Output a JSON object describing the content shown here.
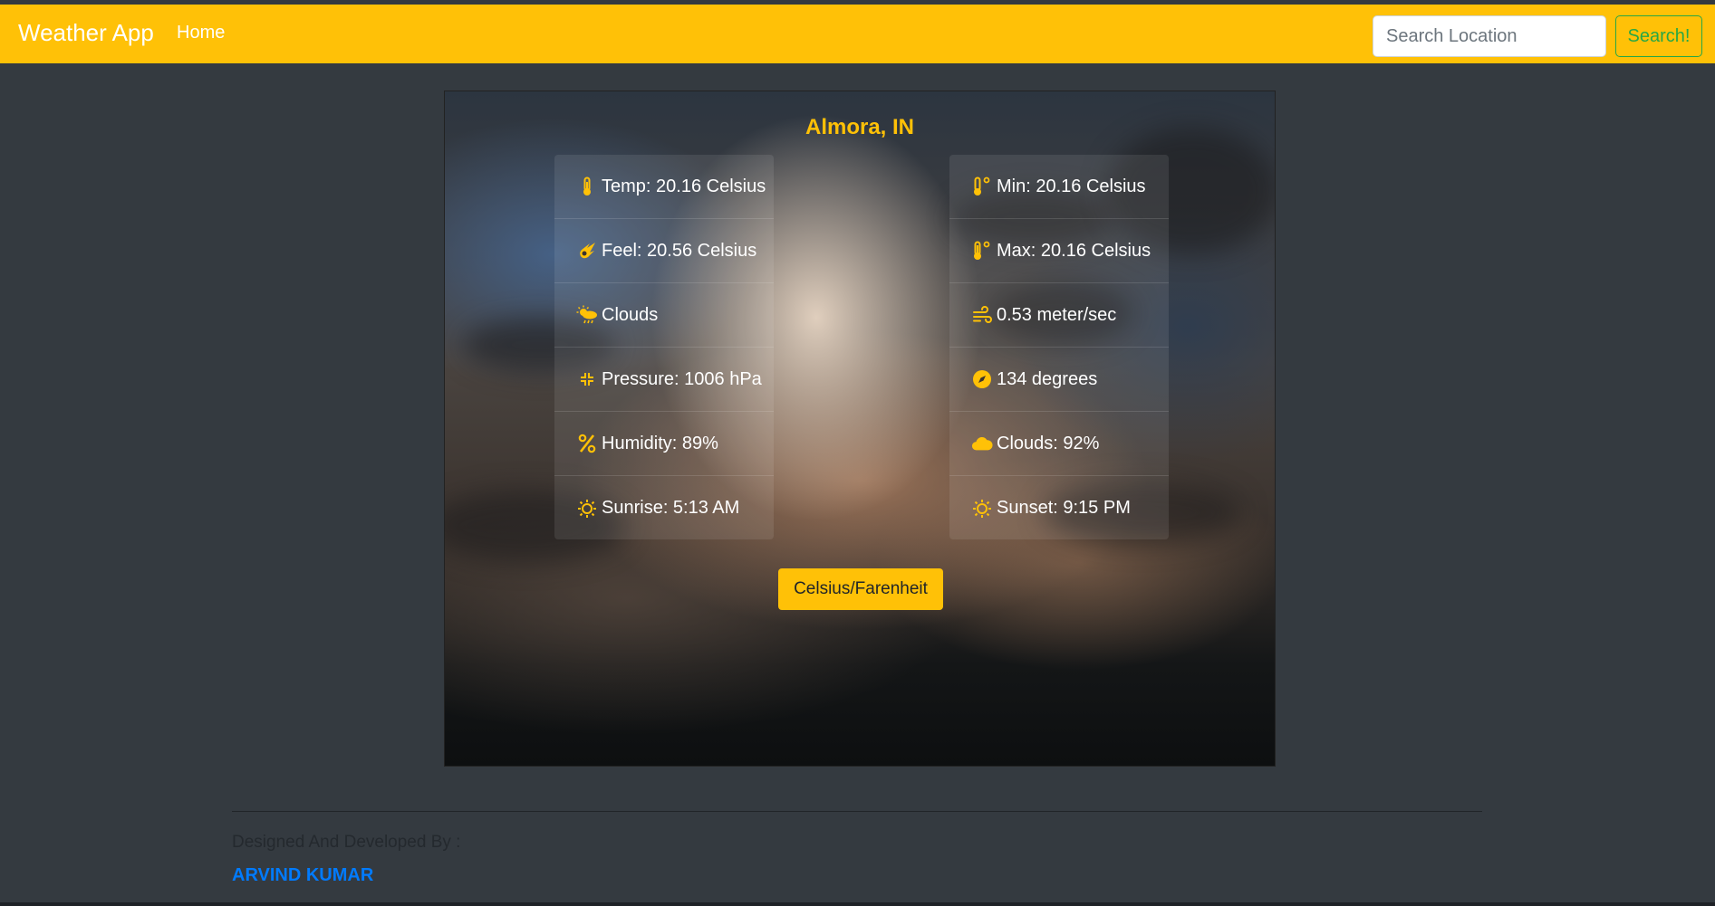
{
  "navbar": {
    "brand": "Weather App",
    "home": "Home",
    "search_placeholder": "Search Location",
    "search_value": "",
    "search_button": "Search!",
    "bg_color": "#ffc107"
  },
  "weather": {
    "location": "Almora, IN",
    "left": [
      {
        "icon": "thermometer-icon",
        "text": "Temp: 20.16 Celsius"
      },
      {
        "icon": "meteor-icon",
        "text": "Feel: 20.56 Celsius"
      },
      {
        "icon": "cloud-sun-rain-icon",
        "text": "Clouds"
      },
      {
        "icon": "compress-arrows-icon",
        "text": "Pressure: 1006 hPa"
      },
      {
        "icon": "percent-icon",
        "text": "Humidity: 89%"
      },
      {
        "icon": "sun-icon",
        "text": "Sunrise: 5:13 AM"
      }
    ],
    "right": [
      {
        "icon": "temperature-low-icon",
        "text": "Min: 20.16 Celsius"
      },
      {
        "icon": "temperature-high-icon",
        "text": "Max: 20.16 Celsius"
      },
      {
        "icon": "wind-icon",
        "text": "0.53 meter/sec"
      },
      {
        "icon": "compass-icon",
        "text": "134 degrees"
      },
      {
        "icon": "cloud-icon",
        "text": "Clouds: 92%"
      },
      {
        "icon": "sun-icon",
        "text": "Sunset: 9:15 PM"
      }
    ],
    "toggle_button": "Celsius/Farenheit",
    "accent_color": "#ffc107"
  },
  "footer": {
    "designed_by": "Designed And Developed By :",
    "author": "ARVIND KUMAR",
    "author_color": "#007bff"
  }
}
